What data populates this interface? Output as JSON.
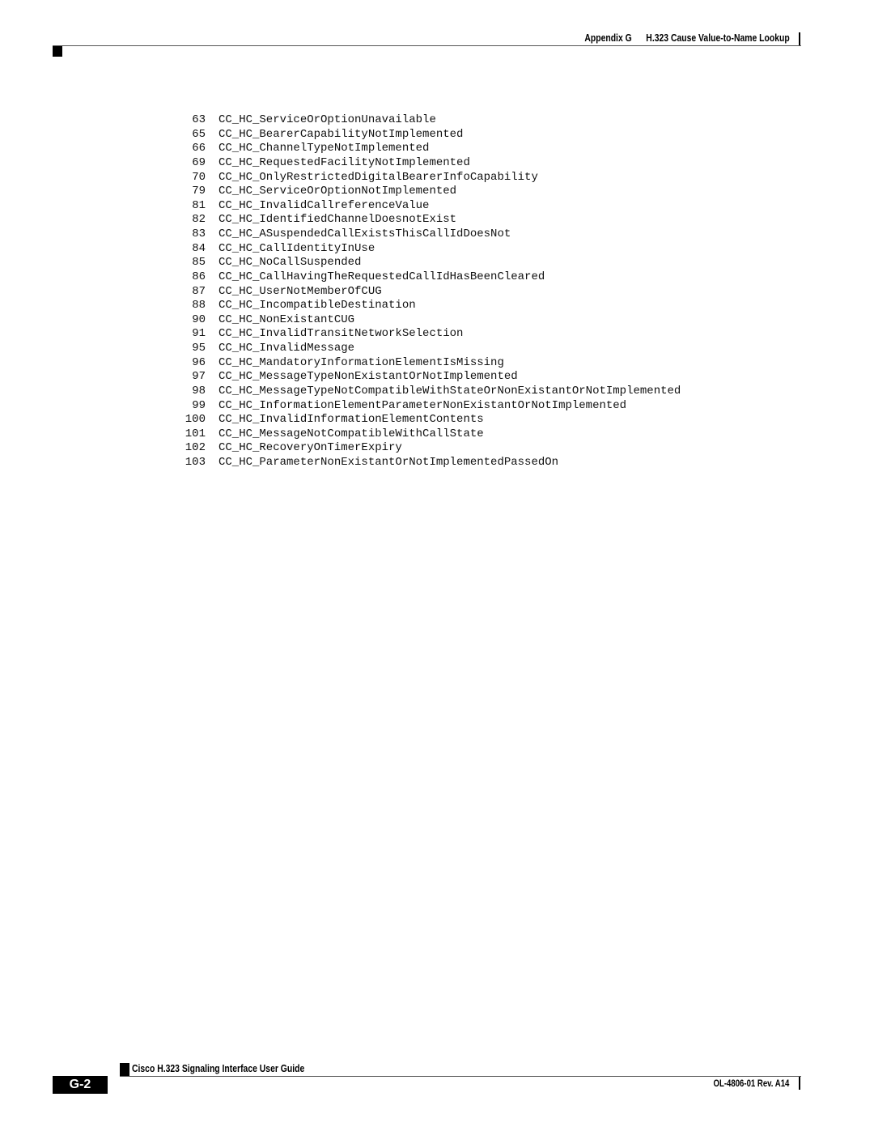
{
  "header": {
    "appendix": "Appendix G",
    "title": "H.323 Cause Value-to-Name Lookup"
  },
  "entries": [
    {
      "value": "63",
      "name": "CC_HC_ServiceOrOptionUnavailable"
    },
    {
      "value": "65",
      "name": "CC_HC_BearerCapabilityNotImplemented"
    },
    {
      "value": "66",
      "name": "CC_HC_ChannelTypeNotImplemented"
    },
    {
      "value": "69",
      "name": "CC_HC_RequestedFacilityNotImplemented"
    },
    {
      "value": "70",
      "name": "CC_HC_OnlyRestrictedDigitalBearerInfoCapability"
    },
    {
      "value": "79",
      "name": "CC_HC_ServiceOrOptionNotImplemented"
    },
    {
      "value": "81",
      "name": "CC_HC_InvalidCallreferenceValue"
    },
    {
      "value": "82",
      "name": "CC_HC_IdentifiedChannelDoesnotExist"
    },
    {
      "value": "83",
      "name": "CC_HC_ASuspendedCallExistsThisCallIdDoesNot"
    },
    {
      "value": "84",
      "name": "CC_HC_CallIdentityInUse"
    },
    {
      "value": "85",
      "name": "CC_HC_NoCallSuspended"
    },
    {
      "value": "86",
      "name": "CC_HC_CallHavingTheRequestedCallIdHasBeenCleared"
    },
    {
      "value": "87",
      "name": "CC_HC_UserNotMemberOfCUG"
    },
    {
      "value": "88",
      "name": "CC_HC_IncompatibleDestination"
    },
    {
      "value": "90",
      "name": "CC_HC_NonExistantCUG"
    },
    {
      "value": "91",
      "name": "CC_HC_InvalidTransitNetworkSelection"
    },
    {
      "value": "95",
      "name": "CC_HC_InvalidMessage"
    },
    {
      "value": "96",
      "name": "CC_HC_MandatoryInformationElementIsMissing"
    },
    {
      "value": "97",
      "name": "CC_HC_MessageTypeNonExistantOrNotImplemented"
    },
    {
      "value": "98",
      "name": "CC_HC_MessageTypeNotCompatibleWithStateOrNonExistantOrNotImplemented"
    },
    {
      "value": "99",
      "name": "CC_HC_InformationElementParameterNonExistantOrNotImplemented"
    },
    {
      "value": "100",
      "name": "CC_HC_InvalidInformationElementContents"
    },
    {
      "value": "101",
      "name": "CC_HC_MessageNotCompatibleWithCallState"
    },
    {
      "value": "102",
      "name": "CC_HC_RecoveryOnTimerExpiry"
    },
    {
      "value": "103",
      "name": "CC_HC_ParameterNonExistantOrNotImplementedPassedOn"
    }
  ],
  "footer": {
    "guide_title": "Cisco H.323 Signaling Interface User Guide",
    "page_number": "G-2",
    "doc_id": "OL-4806-01 Rev. A14"
  }
}
